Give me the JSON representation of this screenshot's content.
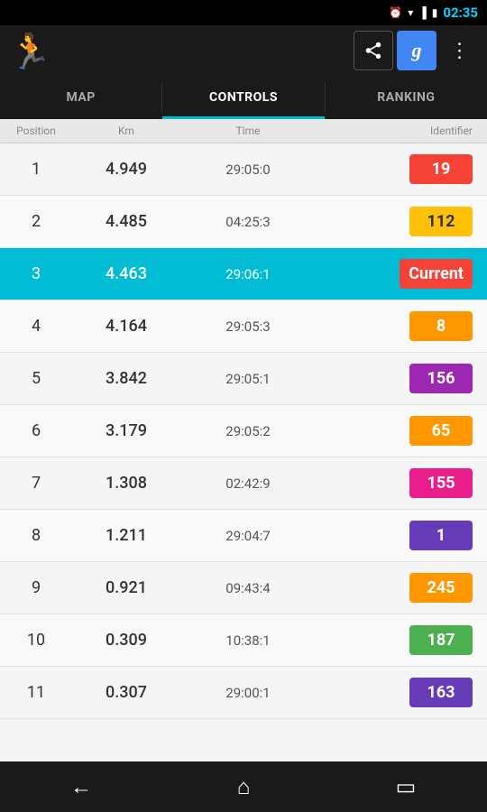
{
  "statusBar": {
    "time": "02:35",
    "icons": [
      "alarm",
      "wifi",
      "signal",
      "battery"
    ]
  },
  "topNav": {
    "shareLabel": "share",
    "googleLabel": "g",
    "moreLabel": "⋮"
  },
  "tabs": [
    {
      "id": "map",
      "label": "MAP",
      "active": false
    },
    {
      "id": "controls",
      "label": "CONTROLS",
      "active": true
    },
    {
      "id": "ranking",
      "label": "RANKING",
      "active": false
    }
  ],
  "tableHeaders": {
    "position": "Position",
    "km": "Km",
    "time": "Time",
    "identifier": "Identifier"
  },
  "rows": [
    {
      "pos": 1,
      "km": "4.949",
      "time": "29:05:0",
      "id": "19",
      "badgeClass": "badge-red",
      "current": false,
      "alt": false
    },
    {
      "pos": 2,
      "km": "4.485",
      "time": "04:25:3",
      "id": "112",
      "badgeClass": "badge-yellow",
      "current": false,
      "alt": true
    },
    {
      "pos": 3,
      "km": "4.463",
      "time": "29:06:1",
      "id": "Current",
      "badgeClass": "badge-current",
      "current": true,
      "alt": false
    },
    {
      "pos": 4,
      "km": "4.164",
      "time": "29:05:3",
      "id": "8",
      "badgeClass": "badge-orange",
      "current": false,
      "alt": true
    },
    {
      "pos": 5,
      "km": "3.842",
      "time": "29:05:1",
      "id": "156",
      "badgeClass": "badge-purple",
      "current": false,
      "alt": false
    },
    {
      "pos": 6,
      "km": "3.179",
      "time": "29:05:2",
      "id": "65",
      "badgeClass": "badge-orange",
      "current": false,
      "alt": true
    },
    {
      "pos": 7,
      "km": "1.308",
      "time": "02:42:9",
      "id": "155",
      "badgeClass": "badge-pink",
      "current": false,
      "alt": false
    },
    {
      "pos": 8,
      "km": "1.211",
      "time": "29:04:7",
      "id": "1",
      "badgeClass": "badge-deep-purple",
      "current": false,
      "alt": true
    },
    {
      "pos": 9,
      "km": "0.921",
      "time": "09:43:4",
      "id": "245",
      "badgeClass": "badge-orange",
      "current": false,
      "alt": false
    },
    {
      "pos": 10,
      "km": "0.309",
      "time": "10:38:1",
      "id": "187",
      "badgeClass": "badge-green",
      "current": false,
      "alt": true
    },
    {
      "pos": 11,
      "km": "0.307",
      "time": "29:00:1",
      "id": "163",
      "badgeClass": "badge-deep-purple",
      "current": false,
      "alt": false
    }
  ],
  "bottomNav": {
    "backLabel": "←",
    "homeLabel": "⌂",
    "recentLabel": "▭"
  }
}
